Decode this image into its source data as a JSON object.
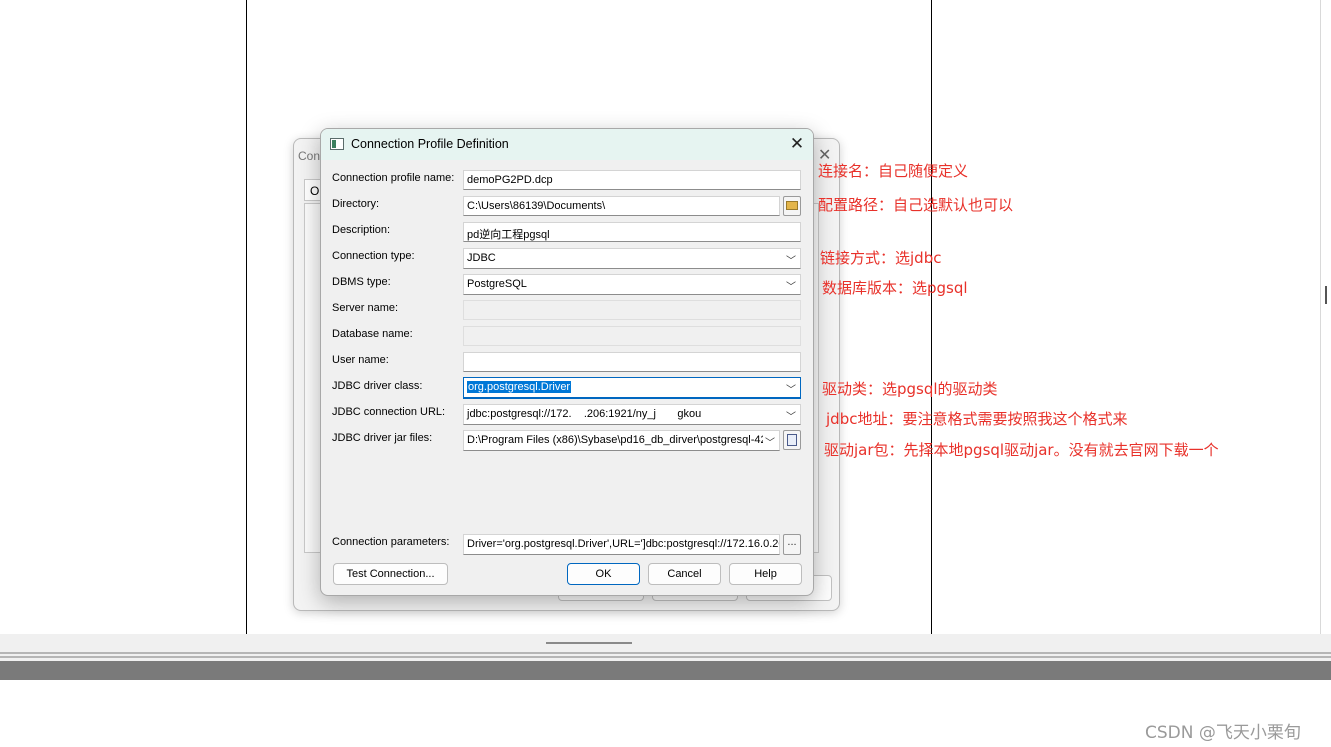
{
  "behind_dialog": {
    "title_partial": "Con",
    "tab_partial": "O"
  },
  "dialog": {
    "title": "Connection Profile Definition",
    "close_glyph": "✕",
    "fields": {
      "profile_name": {
        "label": "Connection profile name:",
        "value": "demoPG2PD.dcp"
      },
      "directory": {
        "label": "Directory:",
        "value": "C:\\Users\\86139\\Documents\\"
      },
      "description": {
        "label": "Description:",
        "value": "pd逆向工程pgsql"
      },
      "connection_type": {
        "label": "Connection type:",
        "value": "JDBC"
      },
      "dbms_type": {
        "label": "DBMS type:",
        "value": "PostgreSQL"
      },
      "server_name": {
        "label": "Server name:",
        "value": ""
      },
      "database_name": {
        "label": "Database name:",
        "value": ""
      },
      "user_name": {
        "label": "User name:",
        "value": ""
      },
      "jdbc_driver_class": {
        "label": "JDBC driver class:",
        "value": "org.postgresql.Driver"
      },
      "jdbc_connection_url": {
        "label": "JDBC connection URL:",
        "value_part1": "jdbc:postgresql://172.",
        "value_part2": ".206:1921/ny_j",
        "value_part3": "gkou"
      },
      "jdbc_driver_jar": {
        "label": "JDBC driver jar files:",
        "value": "D:\\Program Files (x86)\\Sybase\\pd16_db_dirver\\postgresql-42."
      },
      "connection_parameters": {
        "label": "Connection parameters:",
        "value": "Driver='org.postgresql.Driver',URL=']dbc:postgresql://172.16.0.20("
      }
    },
    "buttons": {
      "test_connection": "Test Connection...",
      "ok": "OK",
      "cancel": "Cancel",
      "help": "Help",
      "ellipsis": "..."
    }
  },
  "annotations": [
    "连接名：自己随便定义",
    "配置路径：自己选默认也可以",
    "链接方式：选jdbc",
    "数据库版本：选pgsql",
    "驱动类：选pgsql的驱动类",
    "jdbc地址：要注意格式需要按照我这个格式来",
    "驱动jar包：先择本地pgsql驱动jar。没有就去官网下载一个"
  ],
  "watermark": "CSDN @飞天小栗旬",
  "icons": {
    "window_icon": "app-window-icon",
    "folder": "folder-icon",
    "file": "file-browse-icon",
    "dropdown": "chevron-down-icon"
  },
  "colors": {
    "annotation": "#e8312a",
    "titlebar": "#e6f4f1",
    "accent": "#0067c0"
  }
}
